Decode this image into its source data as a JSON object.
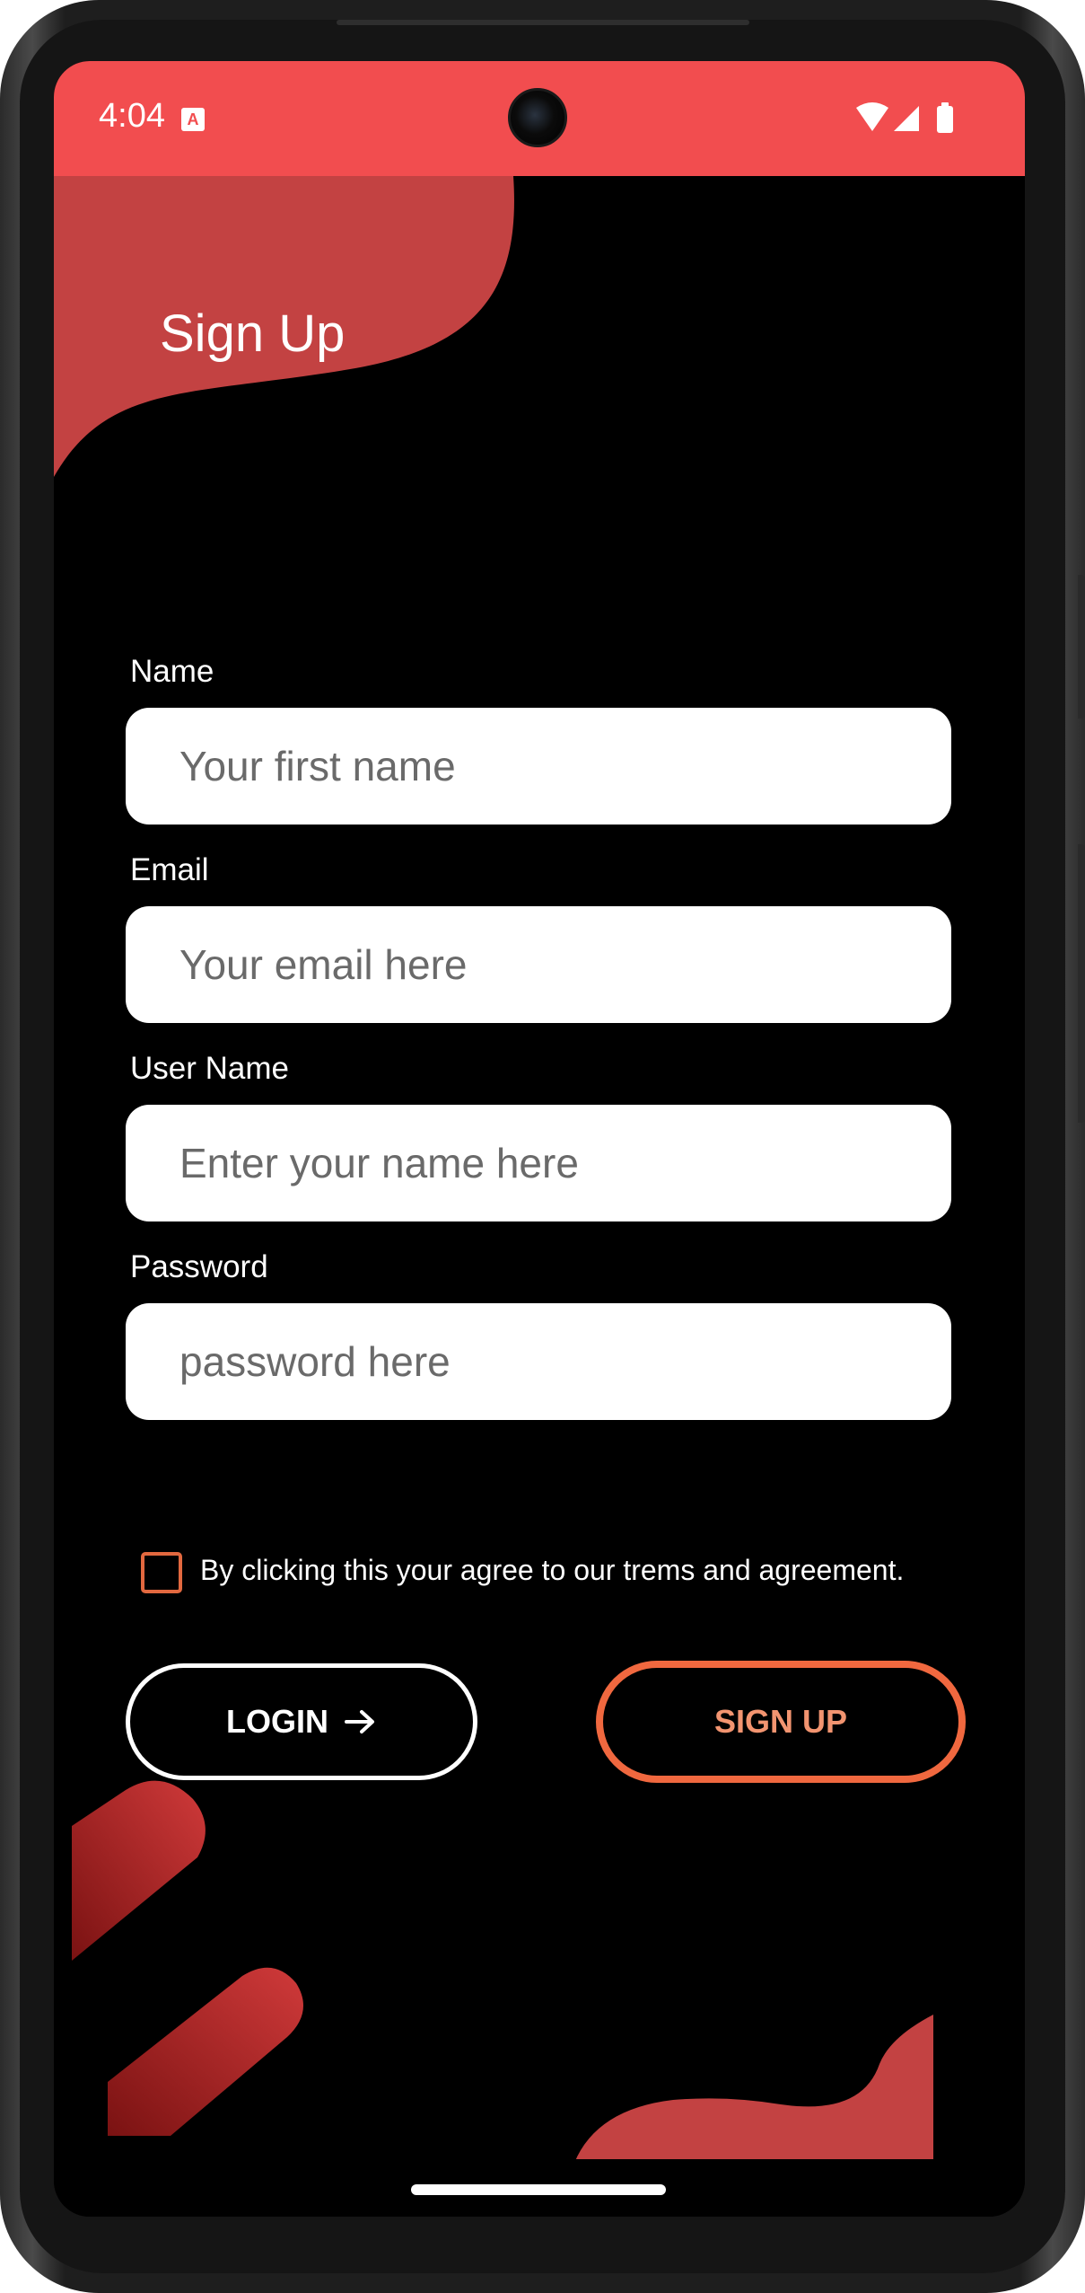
{
  "status_bar": {
    "time": "4:04",
    "notification_icon": "text-a-icon",
    "right_icons": [
      "wifi-icon",
      "signal-icon",
      "battery-icon"
    ]
  },
  "page": {
    "title": "Sign Up"
  },
  "form": {
    "name": {
      "label": "Name",
      "placeholder": "Your first name"
    },
    "email": {
      "label": "Email",
      "placeholder": "Your email here"
    },
    "username": {
      "label": "User Name",
      "placeholder": "Enter your name here"
    },
    "password": {
      "label": "Password",
      "placeholder": "password here"
    },
    "terms_text": "By clicking this your agree to our trems and agreement.",
    "terms_checked": false
  },
  "buttons": {
    "login_label": "LOGIN",
    "login_icon": "arrow-right-icon",
    "signup_label": "SIGN UP"
  },
  "colors": {
    "accent_red": "#f24d4f",
    "accent_orange": "#f0683f",
    "background": "#000000"
  }
}
